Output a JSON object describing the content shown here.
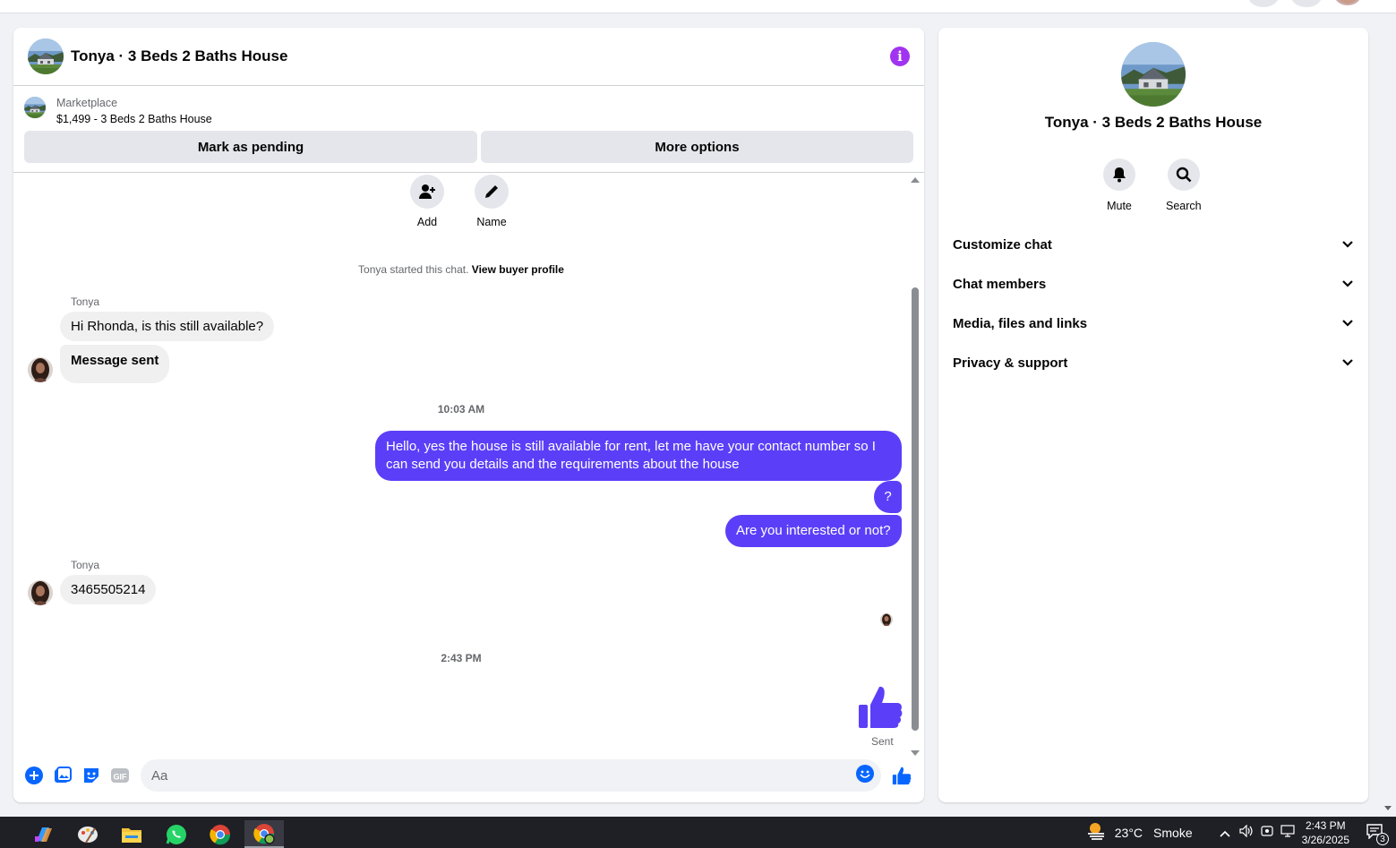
{
  "chat": {
    "title": "Tonya · 3 Beds 2 Baths House",
    "listing": {
      "source": "Marketplace",
      "price_title": "$1,499 - 3 Beds 2 Baths House",
      "mark_pending_label": "Mark as pending",
      "more_options_label": "More options"
    },
    "quick_actions": {
      "add_label": "Add",
      "name_label": "Name"
    },
    "started_text": "Tonya started this chat.",
    "view_profile_label": "View buyer profile",
    "messages": [
      {
        "sender": "Tonya",
        "text": "Hi Rhonda, is this still available?"
      },
      {
        "text": "Message sent"
      },
      {
        "timestamp": "10:03 AM"
      },
      {
        "text": "Hello, yes the house is still available for rent, let me have your contact number so I can send you details and the requirements about the house"
      },
      {
        "text": "?"
      },
      {
        "text": "Are you interested or not?"
      },
      {
        "sender": "Tonya",
        "text": "3465505214"
      },
      {
        "timestamp": "2:43 PM"
      },
      {
        "text": "Sent"
      }
    ],
    "composer": {
      "placeholder": "Aa"
    }
  },
  "side": {
    "title": "Tonya · 3 Beds 2 Baths House",
    "mute_label": "Mute",
    "search_label": "Search",
    "menu": [
      {
        "label": "Customize chat"
      },
      {
        "label": "Chat members"
      },
      {
        "label": "Media, files and links"
      },
      {
        "label": "Privacy & support"
      }
    ]
  },
  "taskbar": {
    "weather": "23°C",
    "weather_desc": "Smoke",
    "time": "2:43 PM",
    "date": "3/26/2025",
    "notification_count": "3"
  },
  "colors": {
    "accent": "#5b3ff8",
    "info": "#a034f0",
    "icon_blue": "#0866ff"
  }
}
